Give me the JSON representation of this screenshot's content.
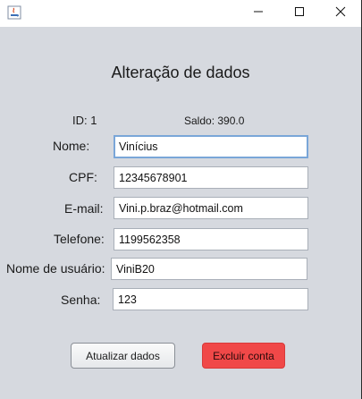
{
  "window": {
    "title": "",
    "controls": {
      "minimize": "minimize-icon",
      "maximize": "maximize-icon",
      "close": "close-icon"
    }
  },
  "form": {
    "heading": "Alteração de dados",
    "id_text": "ID: 1",
    "saldo_text": "Saldo: 390.0",
    "fields": {
      "nome": {
        "label": "Nome:",
        "value": "Vinícius"
      },
      "cpf": {
        "label": "CPF:",
        "value": "12345678901"
      },
      "email": {
        "label": "E-mail:",
        "value": "Vini.p.braz@hotmail.com"
      },
      "telefone": {
        "label": "Telefone:",
        "value": "1199562358"
      },
      "usuario": {
        "label": "Nome de usuário:",
        "value": "ViniB20"
      },
      "senha": {
        "label": "Senha:",
        "value": "123"
      }
    }
  },
  "buttons": {
    "update_label": "Atualizar dados",
    "delete_label": "Excluir conta"
  },
  "colors": {
    "background": "#d6d9df",
    "delete_button": "#f04848",
    "focus_border": "#7aa6d8"
  }
}
